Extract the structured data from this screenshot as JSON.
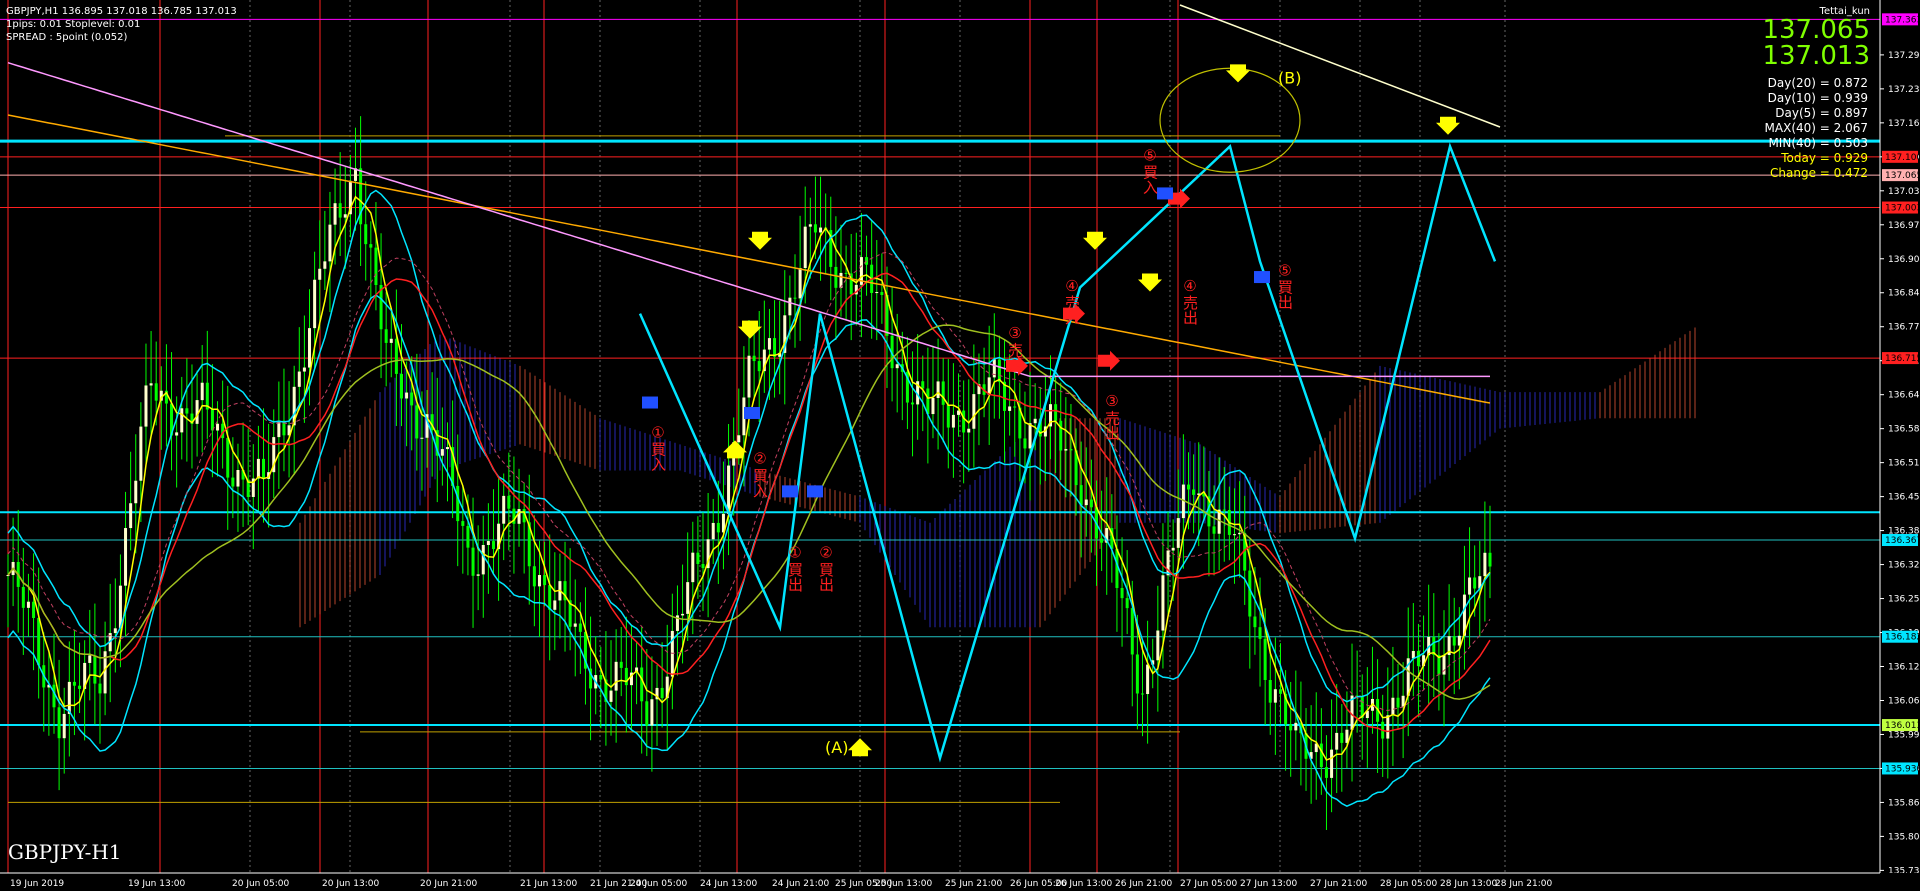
{
  "header": {
    "line1": "GBPJPY,H1  136.895 137.018 136.785 137.013",
    "line2": "1pips: 0.01  Stoplevel: 0.01",
    "line3": "SPREAD : 5point (0.052)"
  },
  "author": "Tettai_kun",
  "symbol_label": "GBPJPY-H1",
  "prices": {
    "bid": "137.065",
    "ask": "137.013"
  },
  "stats": [
    "Day(20) = 0.872",
    "Day(10) = 0.939",
    "Day(5) = 0.897",
    "MAX(40) = 2.067",
    "MIN(40) = 0.503"
  ],
  "stats_yellow": [
    "Today = 0.929",
    "Change = 0.472"
  ],
  "colors": {
    "candle_up": "#ffffcc",
    "candle_down": "#00ff00",
    "ma_white": "#ffffcc",
    "ma_orange": "#ffaa00",
    "ma_red": "#ff2020",
    "ma_pink": "#ff99ff",
    "bb": "#00e5ff",
    "zigzag": "#00e5ff",
    "kijun": "#ffff00",
    "grid_v": "#ff2020",
    "hline_cyan": "#00e5ff"
  },
  "chart_data": {
    "type": "candlestick",
    "ylim": [
      135.73,
      137.4
    ],
    "y_ticks": [
      "137.295",
      "137.230",
      "137.165",
      "137.100",
      "137.035",
      "136.970",
      "136.905",
      "136.840",
      "136.775",
      "136.710",
      "136.645",
      "136.580",
      "136.515",
      "136.450",
      "136.385",
      "136.320",
      "136.255",
      "136.190",
      "136.125",
      "136.060",
      "135.995",
      "135.930",
      "135.865",
      "135.800",
      "135.735"
    ],
    "x_ticks": [
      "19 Jun 2019",
      "19 Jun 13:00",
      "20 Jun 05:00",
      "20 Jun 13:00",
      "20 Jun 21:00",
      "21 Jun 13:00",
      "21 Jun 21:00",
      "24 Jun 05:00",
      "24 Jun 13:00",
      "24 Jun 21:00",
      "25 Jun 05:00",
      "25 Jun 13:00",
      "25 Jun 21:00",
      "26 Jun 05:00",
      "26 Jun 13:00",
      "26 Jun 21:00",
      "27 Jun 05:00",
      "27 Jun 13:00",
      "27 Jun 21:00",
      "28 Jun 05:00",
      "28 Jun 13:00",
      "28 Jun 21:00"
    ],
    "price_boxes": [
      {
        "value": 137.363,
        "label": "137.363",
        "color": "#ff00ff"
      },
      {
        "value": 137.1,
        "label": "137.100",
        "color": "#ff2020"
      },
      {
        "value": 137.065,
        "label": "137.065",
        "color": "#ffb0b0"
      },
      {
        "value": 137.003,
        "label": "137.003",
        "color": "#ff2020"
      },
      {
        "value": 136.715,
        "label": "136.715",
        "color": "#ff2020"
      },
      {
        "value": 136.367,
        "label": "136.367",
        "color": "#00e5ff"
      },
      {
        "value": 136.182,
        "label": "136.182",
        "color": "#00e5ff"
      },
      {
        "value": 136.013,
        "label": "136.013",
        "color": "#c0ff40"
      },
      {
        "value": 135.93,
        "label": "135.930",
        "color": "#00e5ff"
      }
    ],
    "annotations": [
      {
        "label": "(A)",
        "value": 135.96,
        "color": "#ffff00"
      },
      {
        "label": "(B)",
        "value": 137.24,
        "color": "#ffff00"
      }
    ],
    "trade_labels": [
      "①買入",
      "②買入",
      "②買出",
      "①買出",
      "③売入",
      "③売出",
      "④売入",
      "④売出",
      "⑤買入",
      "⑤買出"
    ]
  }
}
